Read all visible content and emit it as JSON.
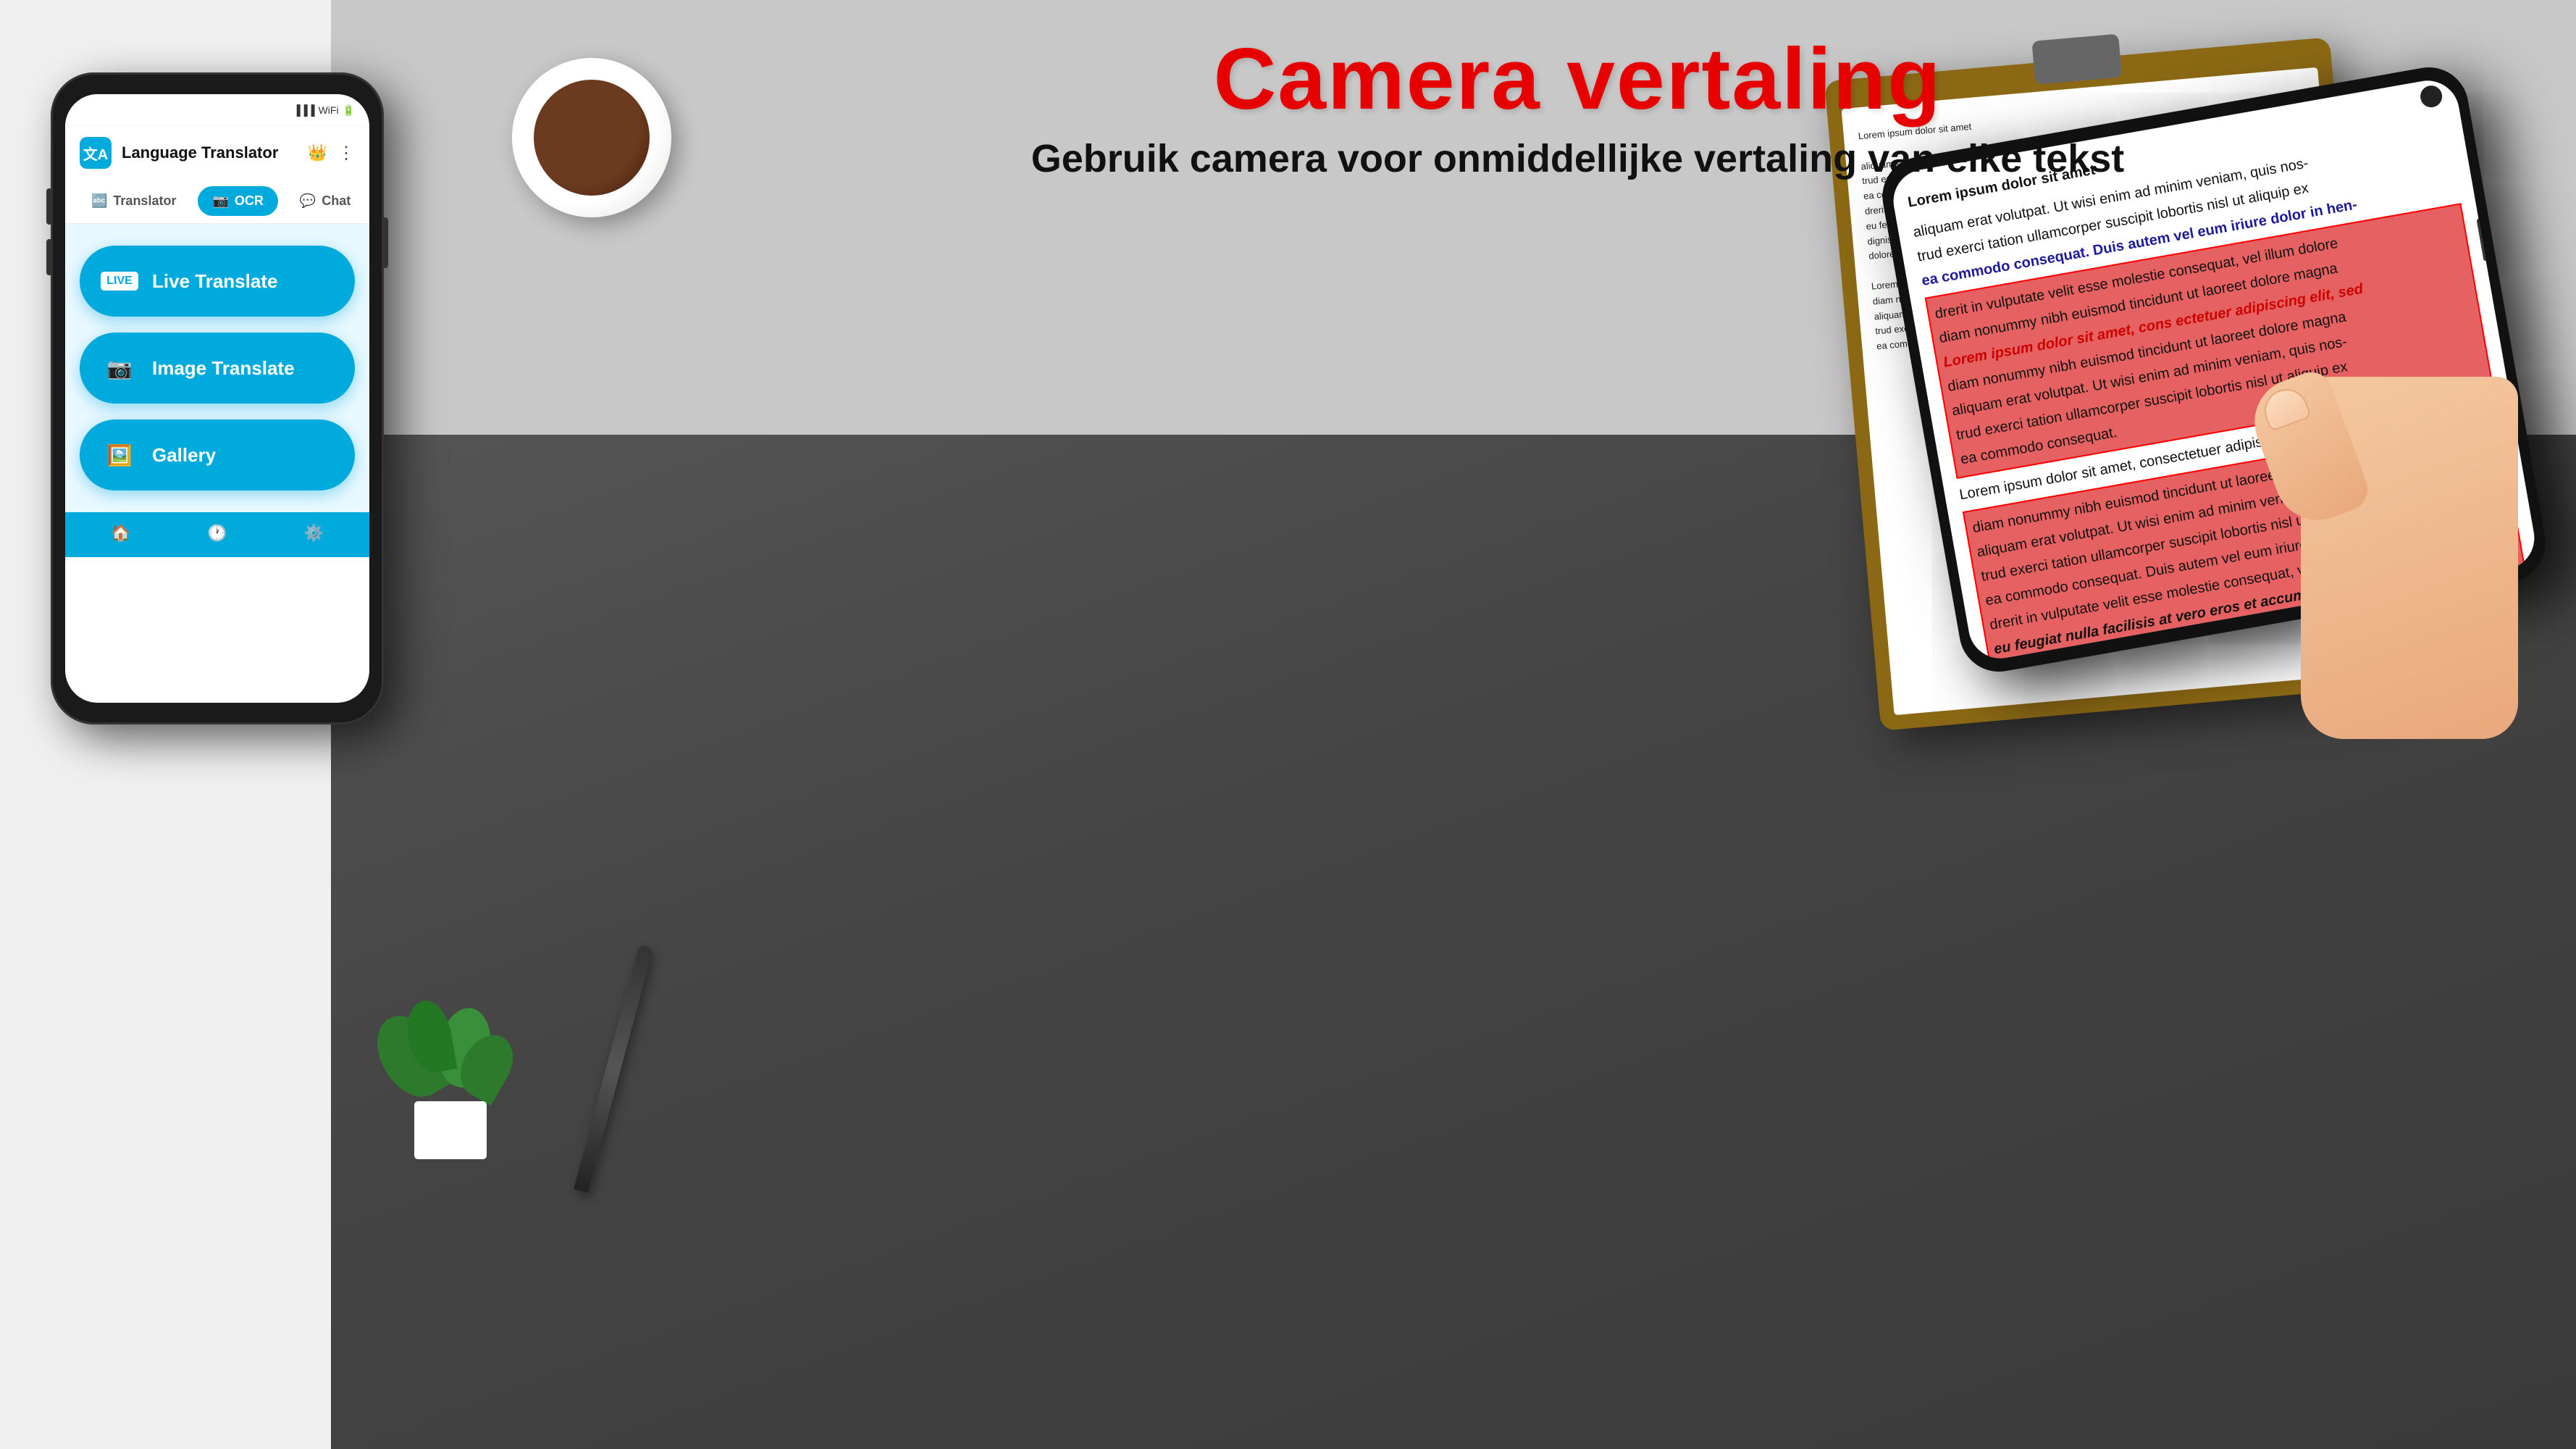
{
  "page": {
    "background_color": "#b0b0b0"
  },
  "heading": {
    "main_title": "Camera vertaling",
    "sub_title": "Gebruik camera voor onmiddellijke vertaling van elke tekst"
  },
  "app": {
    "title": "Language Translator",
    "logo_text": "文A",
    "tabs": [
      {
        "id": "translator",
        "label": "Translator",
        "icon": "🔤",
        "active": false
      },
      {
        "id": "ocr",
        "label": "OCR",
        "icon": "📷",
        "active": true
      },
      {
        "id": "chat",
        "label": "Chat",
        "icon": "💬",
        "active": false
      }
    ],
    "features": [
      {
        "id": "live-translate",
        "label": "Live Translate",
        "icon": "LIVE",
        "badge": "LIVE"
      },
      {
        "id": "image-translate",
        "label": "Image Translate",
        "icon": "📷"
      },
      {
        "id": "gallery",
        "label": "Gallery",
        "icon": "🖼️"
      }
    ]
  },
  "scan_content": {
    "title": "Lorem ipsum dolor sit amet",
    "paragraphs": [
      "aliquam erat volutpat. Ut wisi enim ad minim veniam, quis nos-",
      "trud exerci tation ullamcorper suscipit lobortis nisl ut aliquip ex",
      "ea commodo consequat. Duis autem vel eum iriure dolor in hen-",
      "drerit in vulputate velit esse molestie consequat, vel illum dolore",
      "eu feugiat nulla facilisis at vero eros et accumsan et iusto odio",
      "dignissim qui blandit praesent luptatum zzril delenit augue duis",
      "dolore te feugait nulla facilisi.",
      "Lorem ipsum dolor sit amet, cons ectetuer adipiscing elit, sed",
      "diam nonummy nibh euismod tincidunt ut laoreet dolore magna",
      "aliquam erat volutpat. Ut wisi enim ad minim veniam, quis nos-",
      "trud exerci tation ullamcorper suscipit lobortis nisl ut aliquip ex",
      "ea commodo consequat.",
      "Lorem ipsum dolor sit amet, consectetuer adipiscing elit, sed",
      "diam nonummy nibh euismod tincidunt ut laoreet dolore magna",
      "aliquam erat volutpat. Ut wisi enim ad minim veniam, quis nos-",
      "trud exerci tation ullamcorper suscipit lobortis nisl ut aliquip ex",
      "ea commodo consequat. Duis autem vel eum iriure dolor in hen-",
      "drerit in vulputate velit esse molestie consequat, vel illum dolore",
      "eu feugiat nulla facilisis at vero eros et accumsan et iusto dolore"
    ]
  }
}
